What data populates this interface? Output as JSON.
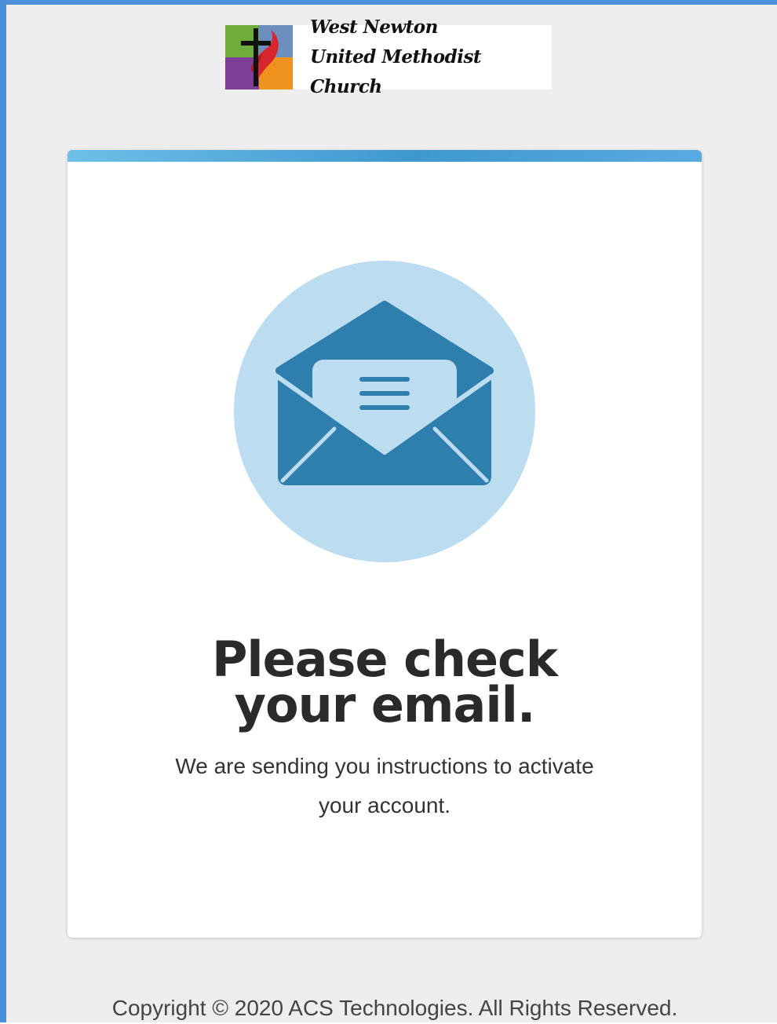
{
  "header": {
    "logo": {
      "line1": "West Newton",
      "line2": "United Methodist Church"
    }
  },
  "card": {
    "icon": "open-envelope-icon",
    "heading_line1": "Please check",
    "heading_line2": "your email.",
    "message_line1": "We are sending you instructions to activate",
    "message_line2": "your account."
  },
  "footer": {
    "copyright": "Copyright © 2020 ACS Technologies. All Rights Reserved."
  },
  "colors": {
    "accent": "#4a90d9",
    "bar_light": "#6fbfe8",
    "bar_dark": "#3e98d0",
    "circle": "#bcdcf0",
    "envelope": "#2f7fae"
  }
}
